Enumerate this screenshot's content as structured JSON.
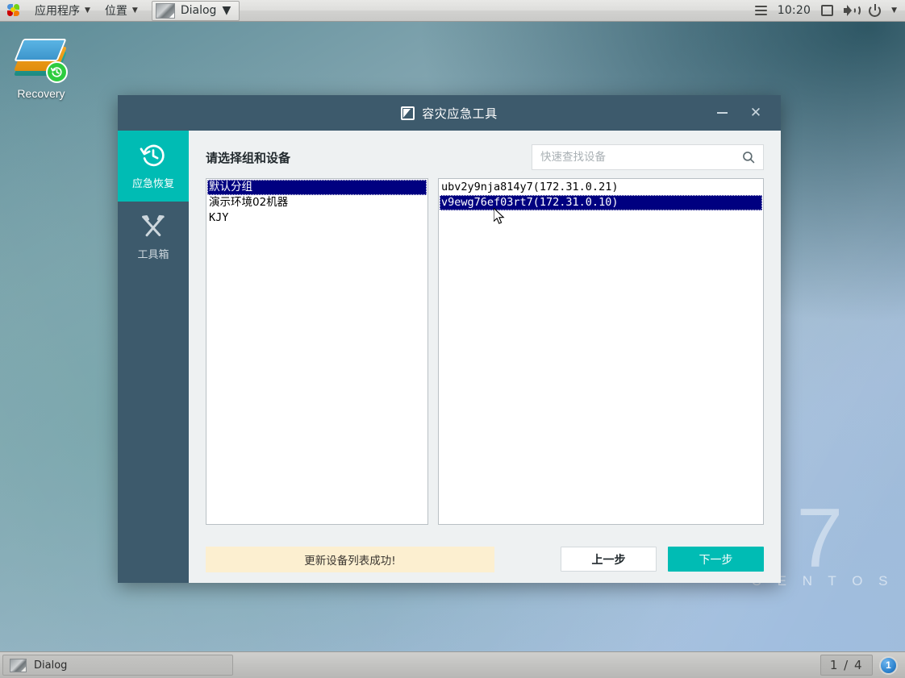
{
  "top_panel": {
    "logo_icon": "gnome-footprint-icon",
    "menus": [
      {
        "label": "应用程序",
        "caret": "▼"
      },
      {
        "label": "位置",
        "caret": "▼"
      }
    ],
    "window_button": {
      "label": "Dialog",
      "caret": "▼",
      "thumb_icon": "window-thumbnail-icon"
    },
    "status": {
      "menu_icon": "hamburger-icon",
      "clock": "10:20",
      "display_icon": "display-icon",
      "volume_icon": "speaker-icon",
      "power_icon": "power-icon",
      "caret": "▼"
    }
  },
  "desktop": {
    "icon": {
      "label": "Recovery",
      "icon": "recovery-books-clock-icon"
    },
    "watermark": {
      "version": "7",
      "name": "C E N T O S"
    }
  },
  "dialog": {
    "title": "容灾应急工具",
    "title_icon": "app-logo-icon",
    "minimize_label": "−",
    "close_label": "✕",
    "sidebar": {
      "items": [
        {
          "label": "应急恢复",
          "icon": "history-clock-icon",
          "active": true
        },
        {
          "label": "工具箱",
          "icon": "tools-hammer-wrench-icon",
          "active": false
        }
      ]
    },
    "pane_title": "请选择组和设备",
    "search": {
      "value": "",
      "placeholder": "快速查找设备",
      "icon": "search-icon"
    },
    "group_list": {
      "items": [
        {
          "text": "默认分组",
          "selected": true,
          "cjk": true
        },
        {
          "text": "演示环境02机器",
          "selected": false,
          "cjk": true
        },
        {
          "text": "KJY",
          "selected": false,
          "cjk": false
        }
      ]
    },
    "device_list": {
      "items": [
        {
          "text": "ubv2y9nja814y7(172.31.0.21)",
          "selected": false
        },
        {
          "text": "v9ewg76ef03rt7(172.31.0.10)",
          "selected": true
        }
      ]
    },
    "status_banner": "更新设备列表成功!",
    "buttons": {
      "previous": "上一步",
      "next": "下一步"
    }
  },
  "bottom_panel": {
    "task": {
      "label": "Dialog",
      "icon": "window-thumbnail-icon"
    },
    "workspace": "1 / 4",
    "badge": "1"
  },
  "colors": {
    "dialog_chrome": "#3d5a6c",
    "accent_teal": "#00bcb4",
    "selection_blue": "#000080",
    "status_banner": "#fcefd0",
    "dialog_body": "#eef1f2"
  }
}
